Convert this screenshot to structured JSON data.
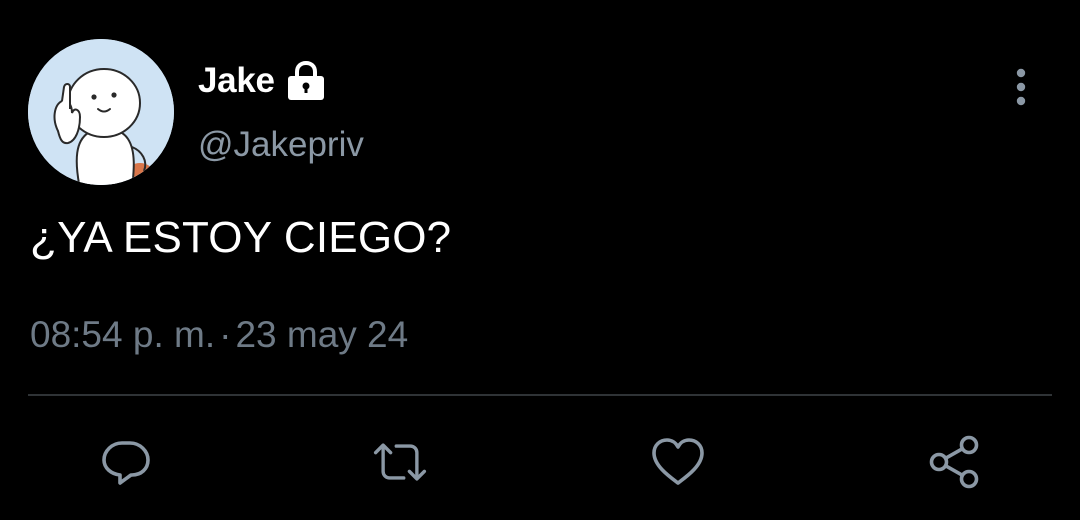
{
  "user": {
    "display_name": "Jake",
    "handle": "@Jakepriv",
    "protected_icon": "lock-icon",
    "avatar_icon": "cartoon-avatar"
  },
  "tweet": {
    "text": "¿YA ESTOY CIEGO?",
    "time": "08:54 p. m.",
    "separator": "·",
    "date": "23 may 24"
  },
  "actions": [
    {
      "name": "reply",
      "icon": "reply-icon"
    },
    {
      "name": "retweet",
      "icon": "retweet-icon"
    },
    {
      "name": "like",
      "icon": "heart-icon"
    },
    {
      "name": "share",
      "icon": "share-icon"
    }
  ],
  "more_icon": "more-vertical-icon",
  "colors": {
    "background": "#000000",
    "primary_text": "#ffffff",
    "secondary_text": "#8b98a5",
    "icon": "#8b98a5",
    "divider": "#2f3336"
  }
}
